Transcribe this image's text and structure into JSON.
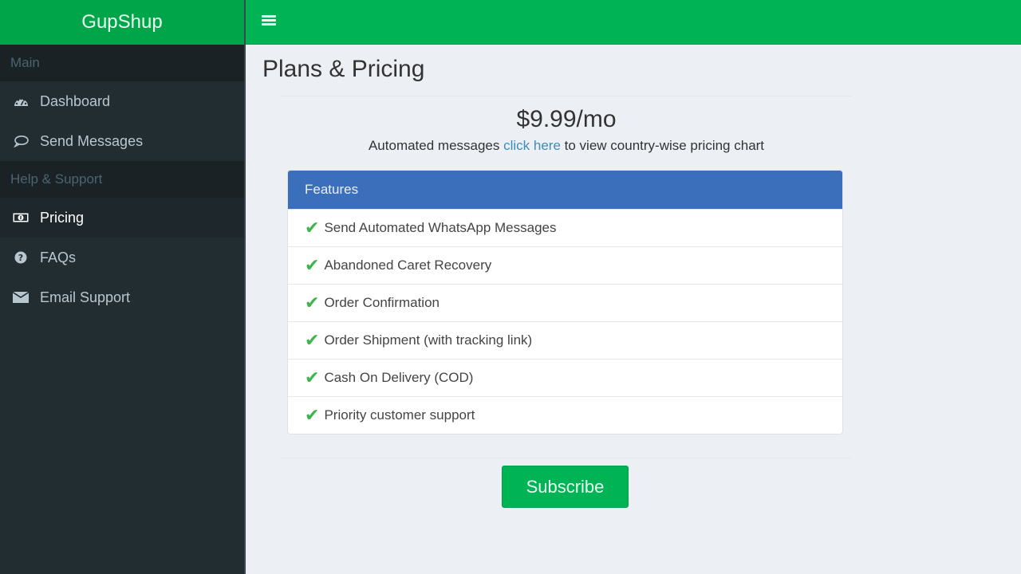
{
  "app": {
    "brand": "GupShup"
  },
  "topbar": {
    "menu_icon": "hamburger-icon"
  },
  "sidebar": {
    "sections": [
      {
        "header": "Main",
        "items": [
          {
            "label": "Dashboard",
            "icon": "dashboard-icon",
            "active": false
          },
          {
            "label": "Send Messages",
            "icon": "chat-bubble-icon",
            "active": false
          }
        ]
      },
      {
        "header": "Help & Support",
        "items": [
          {
            "label": "Pricing",
            "icon": "money-icon",
            "active": true
          },
          {
            "label": "FAQs",
            "icon": "question-circle-icon",
            "active": false
          },
          {
            "label": "Email Support",
            "icon": "envelope-icon",
            "active": false
          }
        ]
      }
    ]
  },
  "main": {
    "title": "Plans & Pricing",
    "price": "$9.99/mo",
    "subtitle": {
      "before": "Automated messages ",
      "link": "click here",
      "after": " to view country-wise pricing chart"
    },
    "features_panel": {
      "heading": "Features",
      "check_icon": "checkmark-icon",
      "items": [
        "Send Automated WhatsApp Messages",
        "Abandoned Caret Recovery",
        "Order Confirmation",
        "Order Shipment (with tracking link)",
        "Cash On Delivery (COD)",
        "Priority customer support"
      ]
    },
    "subscribe_label": "Subscribe"
  },
  "colors": {
    "brand_green": "#00a54a",
    "topbar_green": "#00b355",
    "sidebar_bg": "#222d32",
    "panel_heading": "#3b6fbb",
    "link": "#3c8dbc",
    "check": "#3cb54a"
  }
}
